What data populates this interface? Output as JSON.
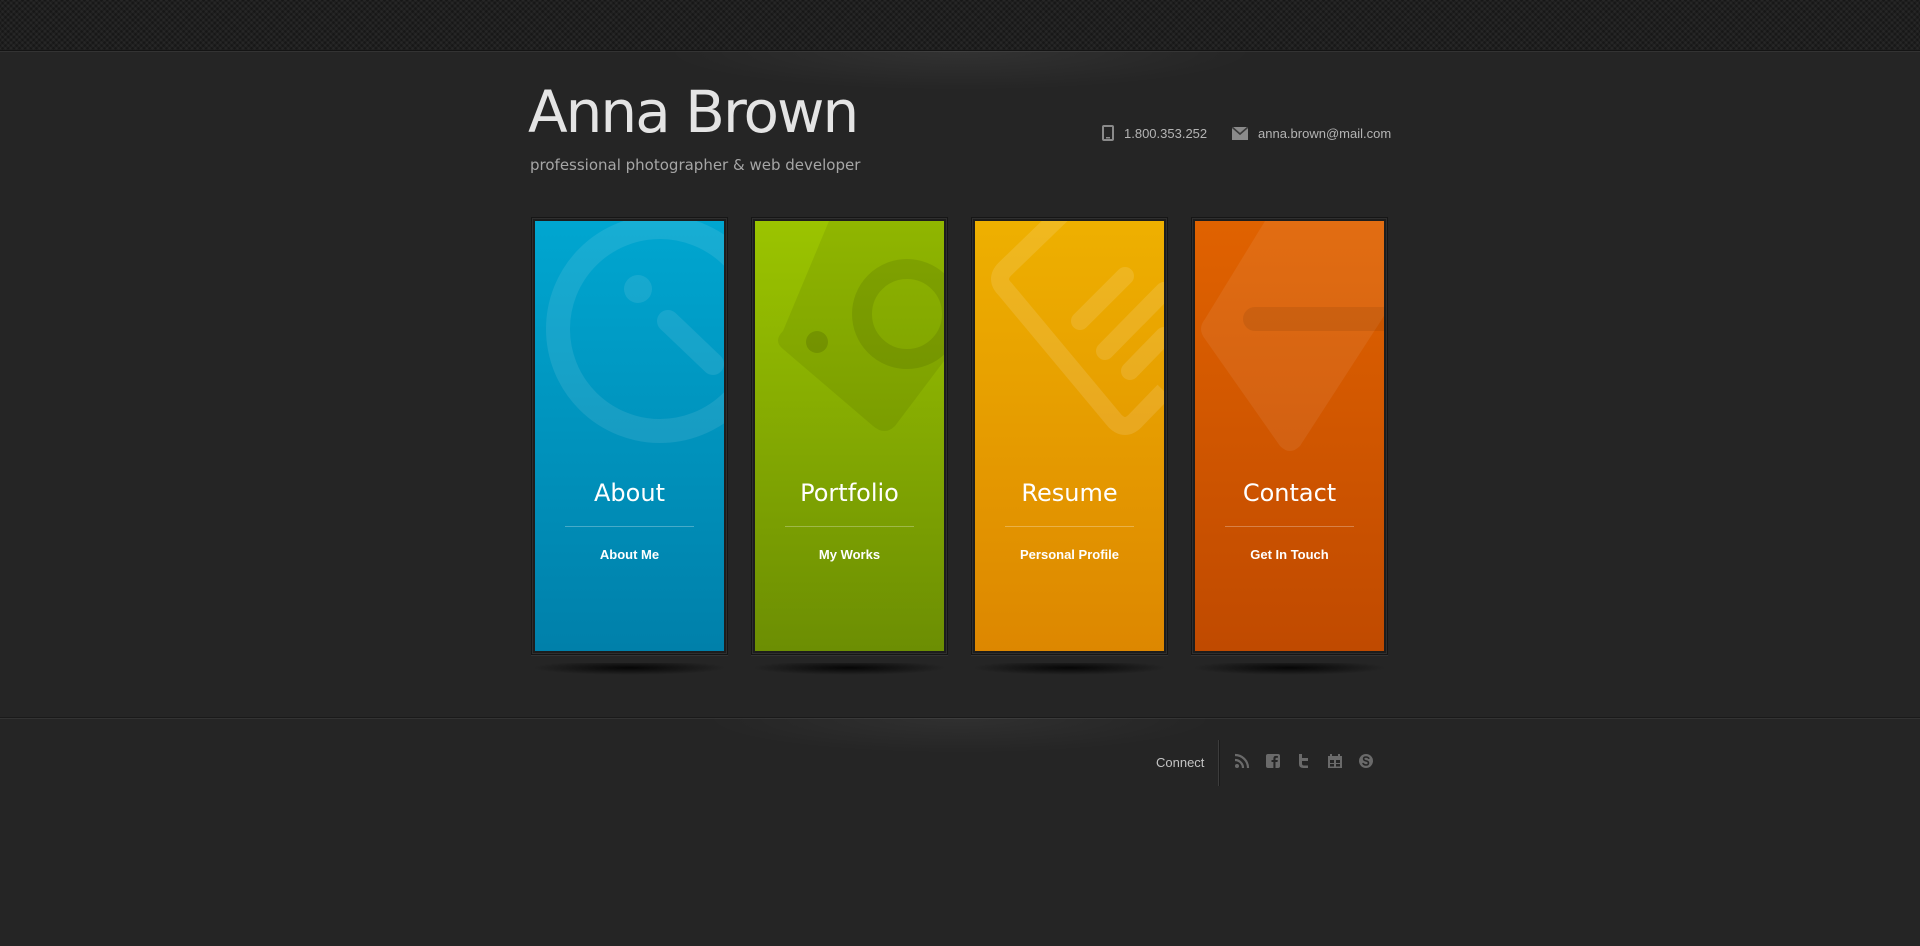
{
  "header": {
    "name": "Anna Brown",
    "tagline": "professional photographer & web developer",
    "phone": "1.800.353.252",
    "email": "anna.brown@mail.com",
    "phone_icon": "phone-icon",
    "email_icon": "envelope-icon"
  },
  "tiles": [
    {
      "title": "About",
      "subtitle": "About Me",
      "icon": "clock-icon",
      "color_top": "#00a6d0",
      "color_bottom": "#0080aa"
    },
    {
      "title": "Portfolio",
      "subtitle": "My Works",
      "icon": "tag-camera-icon",
      "color_top": "#9bc400",
      "color_bottom": "#6c8e03"
    },
    {
      "title": "Resume",
      "subtitle": "Personal Profile",
      "icon": "document-icon",
      "color_top": "#eeb000",
      "color_bottom": "#dd8700"
    },
    {
      "title": "Contact",
      "subtitle": "Get In Touch",
      "icon": "tag-icon",
      "color_top": "#e06200",
      "color_bottom": "#c04a00"
    }
  ],
  "footer": {
    "connect_label": "Connect",
    "social": [
      "rss-icon",
      "facebook-icon",
      "twitter-icon",
      "calendar-icon",
      "skype-icon"
    ]
  },
  "colors": {
    "background": "#252525",
    "topbar": "#1f1f1f",
    "title_text": "#e4e4e4",
    "tagline_text": "#a6a6a6",
    "social_icon": "#6a6a6a"
  }
}
